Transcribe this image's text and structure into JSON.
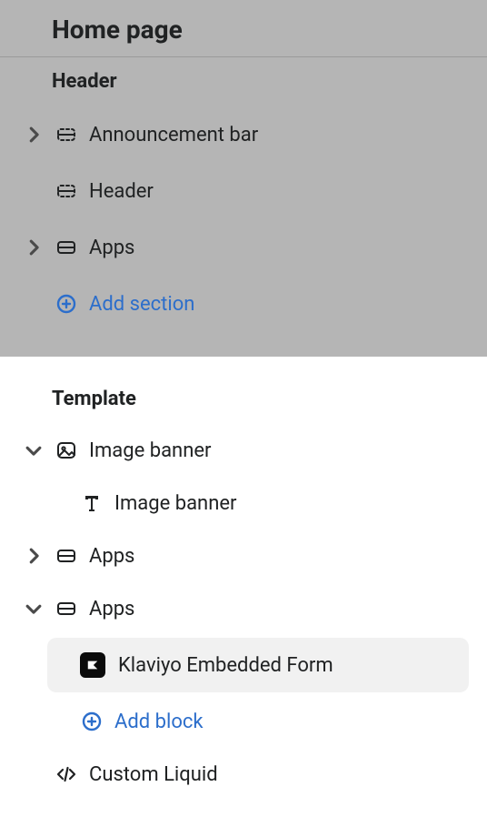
{
  "page_title": "Home page",
  "groups": {
    "header": {
      "label": "Header",
      "items": [
        {
          "label": "Announcement bar"
        },
        {
          "label": "Header"
        },
        {
          "label": "Apps"
        }
      ],
      "add_section": "Add section"
    },
    "template": {
      "label": "Template",
      "image_banner": {
        "label": "Image banner",
        "child_label": "Image banner"
      },
      "apps_collapsed": {
        "label": "Apps"
      },
      "apps_expanded": {
        "label": "Apps",
        "block": "Klaviyo Embedded Form",
        "add_block": "Add block"
      },
      "custom_liquid": {
        "label": "Custom Liquid"
      }
    }
  },
  "colors": {
    "link": "#2c6ecb",
    "top_bg": "#b5b5b5"
  }
}
